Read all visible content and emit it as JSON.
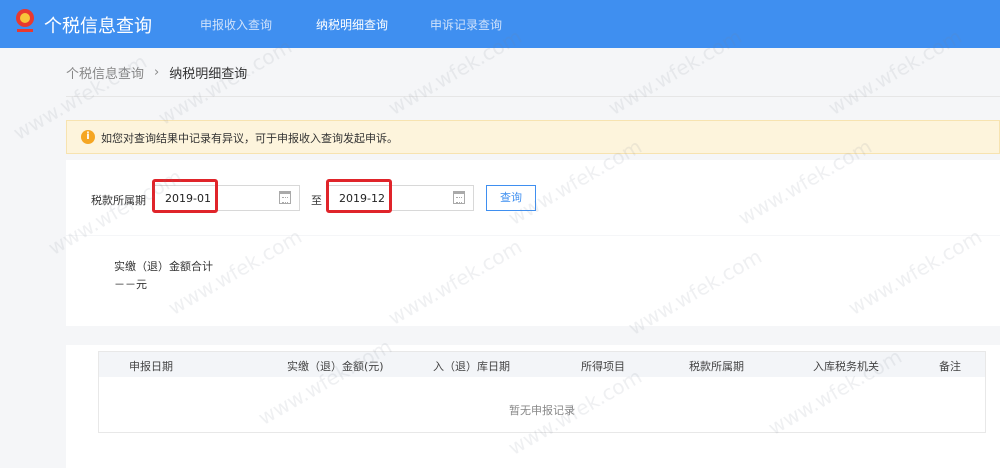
{
  "header": {
    "title": "个税信息查询",
    "nav": [
      "申报收入查询",
      "纳税明细查询",
      "申诉记录查询"
    ],
    "active_index": 1
  },
  "breadcrumb": {
    "parent": "个税信息查询",
    "separator": "›",
    "current": "纳税明细查询"
  },
  "notice": {
    "text": "如您对查询结果中记录有异议，可于申报收入查询发起申诉。"
  },
  "filter": {
    "label": "税款所属期",
    "start": "2019-01",
    "to": "至",
    "end": "2019-12",
    "button": "查询"
  },
  "summary": {
    "label": "实缴（退）金额合计",
    "value": "－－元"
  },
  "table": {
    "columns": [
      "申报日期",
      "实缴（退）金额(元)",
      "入（退）库日期",
      "所得项目",
      "税款所属期",
      "入库税务机关",
      "备注"
    ],
    "empty_text": "暂无申报记录"
  },
  "watermark": "www.wfek.com",
  "colors": {
    "nav": "#3f8ff0",
    "highlight": "#e0242a",
    "notice_bg": "#fdf4dc"
  }
}
